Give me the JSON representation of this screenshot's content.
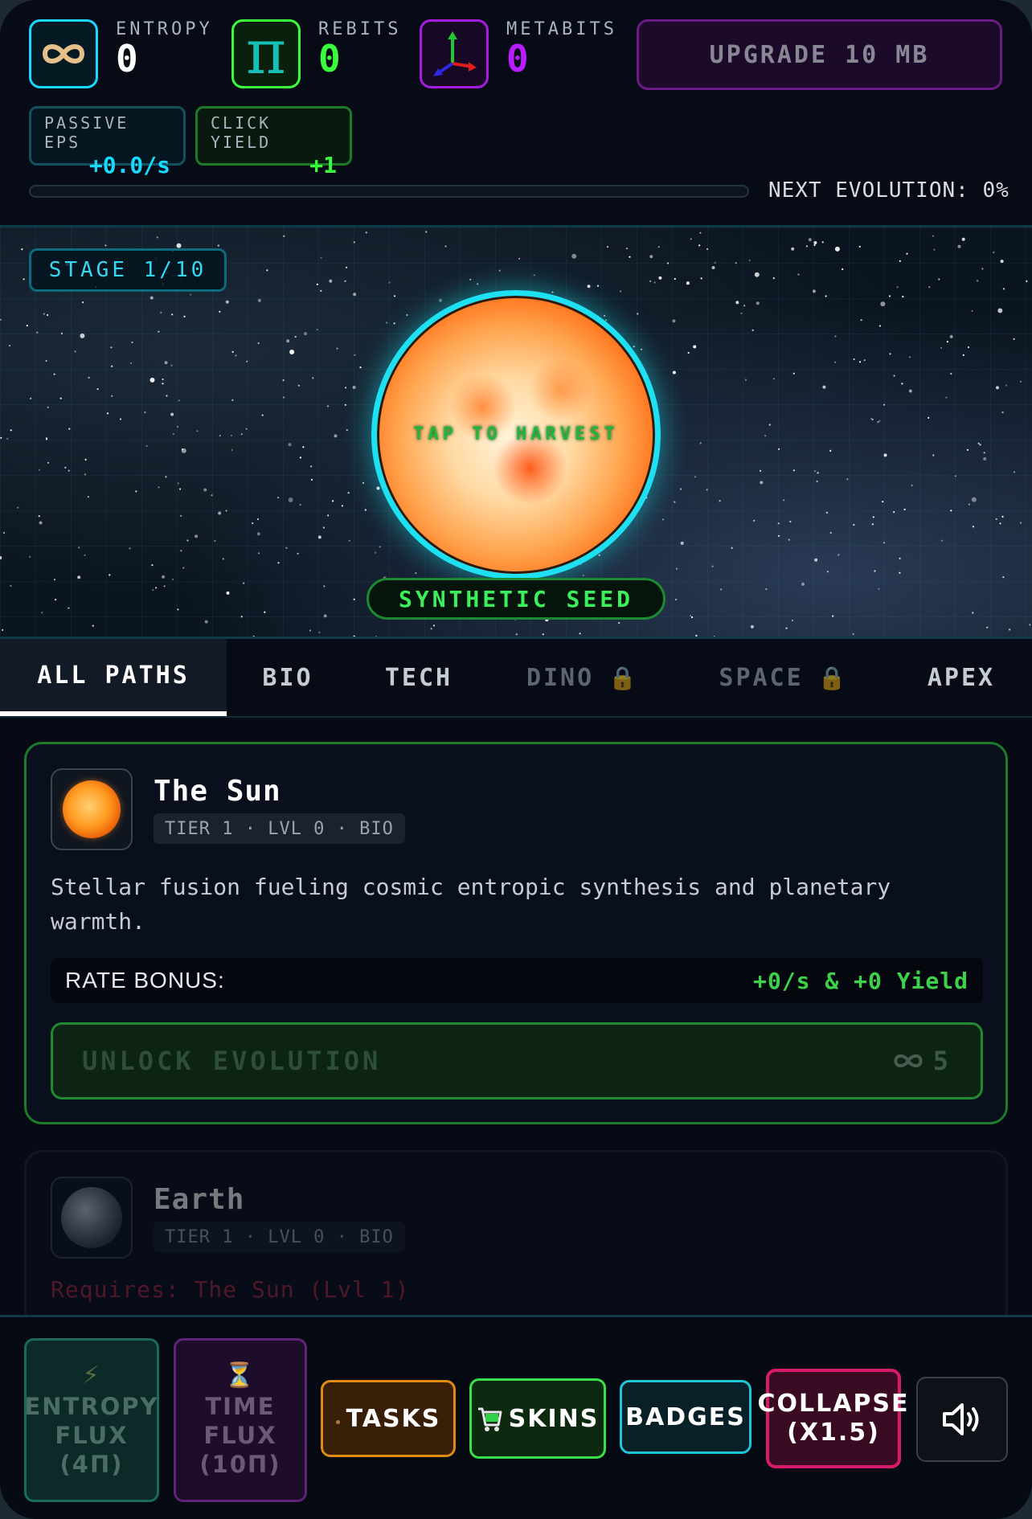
{
  "resources": {
    "entropy": {
      "label": "ENTROPY",
      "value": "0",
      "icon": "infinity-icon",
      "color": "#1ad8ff"
    },
    "rebits": {
      "label": "REBITS",
      "value": "0",
      "icon": "pi-icon",
      "color": "#39ff3c"
    },
    "metabits": {
      "label": "METABITS",
      "value": "0",
      "icon": "axes-icon",
      "color": "#b81cff"
    }
  },
  "upgrade_button": {
    "label": "UPGRADE 10 MB"
  },
  "stats": {
    "passive": {
      "label": "PASSIVE EPS",
      "value": "+0.0/s"
    },
    "click": {
      "label": "CLICK YIELD",
      "value": "+1"
    }
  },
  "evolution": {
    "label": "NEXT EVOLUTION: 0%",
    "progress_percent": 0
  },
  "scene": {
    "stage_label": "STAGE 1/10",
    "tap_hint": "TAP TO HARVEST",
    "stage_name": "SYNTHETIC SEED"
  },
  "tabs": [
    {
      "label": "ALL PATHS",
      "active": true,
      "locked": false
    },
    {
      "label": "BIO",
      "active": false,
      "locked": false
    },
    {
      "label": "TECH",
      "active": false,
      "locked": false
    },
    {
      "label": "DINO",
      "active": false,
      "locked": true
    },
    {
      "label": "SPACE",
      "active": false,
      "locked": true
    },
    {
      "label": "APEX",
      "active": false,
      "locked": false
    }
  ],
  "lock_glyph": "🔒",
  "cards": [
    {
      "title": "The Sun",
      "meta": "TIER 1 · LVL 0 · BIO",
      "description": "Stellar fusion fueling cosmic entropic synthesis and planetary warmth.",
      "rate_label": "RATE BONUS:",
      "rate_value": "+0/s & +0 Yield",
      "button_label": "UNLOCK EVOLUTION",
      "cost": "5"
    },
    {
      "title": "Earth",
      "meta": "TIER 1 · LVL 0 · BIO",
      "requirement": "Requires: The Sun (Lvl 1)"
    }
  ],
  "bottom_bar": {
    "entropy_flux": {
      "icon": "⚡",
      "line1": "ENTROPY",
      "line2": "FLUX",
      "line3": "(4Π)"
    },
    "time_flux": {
      "icon": "⏳",
      "line1": "TIME",
      "line2": "FLUX",
      "line3": "(10Π)"
    },
    "tasks": {
      "label": "TASKS"
    },
    "skins": {
      "label": "SKINS"
    },
    "badges": {
      "label": "BADGES"
    },
    "collapse": {
      "line1": "COLLAPSE",
      "line2": "(X1.5)"
    },
    "sound": {
      "icon": "speaker-icon"
    }
  },
  "colors": {
    "accent_cyan": "#1de1f2",
    "accent_green": "#39ff3c",
    "accent_purple": "#b81cff",
    "danger": "#d81a6a"
  }
}
